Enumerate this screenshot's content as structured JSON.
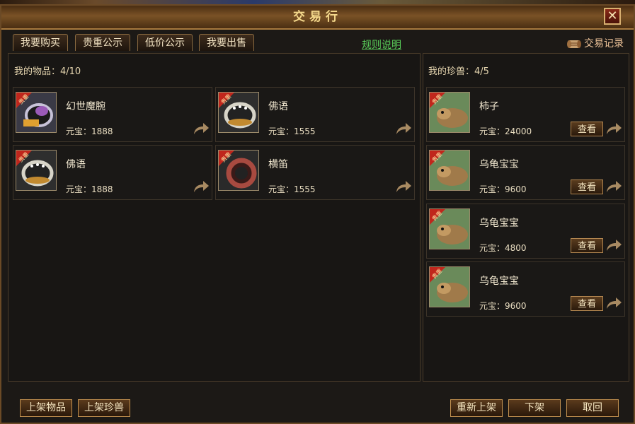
{
  "window": {
    "title": "交易行",
    "close_glyph": "✕"
  },
  "tabs": [
    {
      "label": "我要购买"
    },
    {
      "label": "贵重公示"
    },
    {
      "label": "低价公示"
    },
    {
      "label": "我要出售"
    }
  ],
  "rules_link": "规则说明",
  "trade_record": "交易记录",
  "items_panel": {
    "label": "我的物品：4/10",
    "items": [
      {
        "name": "幻世魔腕",
        "price": "元宝：1888",
        "badge": "贵重"
      },
      {
        "name": "佛语",
        "price": "元宝：1555",
        "badge": "贵重"
      },
      {
        "name": "佛语",
        "price": "元宝：1888",
        "badge": "贵重"
      },
      {
        "name": "横笛",
        "price": "元宝：1555",
        "badge": "贵重"
      }
    ]
  },
  "pets_panel": {
    "label": "我的珍兽：4/5",
    "view_label": "查看",
    "pets": [
      {
        "name": "柿子",
        "price": "元宝：24000",
        "badge": "贵重"
      },
      {
        "name": "乌龟宝宝",
        "price": "元宝：9600",
        "badge": "贵重"
      },
      {
        "name": "乌龟宝宝",
        "price": "元宝：4800",
        "badge": "贵重"
      },
      {
        "name": "乌龟宝宝",
        "price": "元宝：9600",
        "badge": "贵重"
      }
    ]
  },
  "bottom_buttons": {
    "list_item": "上架物品",
    "list_pet": "上架珍兽",
    "relist": "重新上架",
    "delist": "下架",
    "cancel": "取回"
  },
  "colors": {
    "frame": "#6b4a26",
    "accent_gold": "#f5d98c",
    "link_green": "#5ad05a",
    "badge_red": "#c0261c"
  }
}
